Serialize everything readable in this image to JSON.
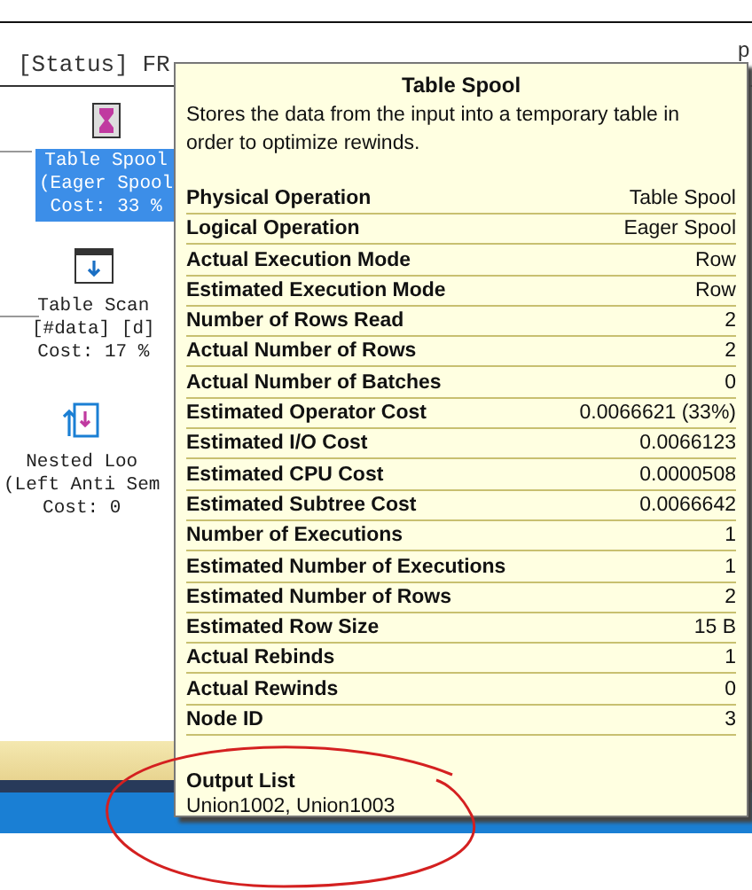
{
  "plan_header": {
    "text": "[Status] FR",
    "tail": "p"
  },
  "nodes": [
    {
      "kind": "spool",
      "selected": true,
      "lines": [
        "Table Spool",
        "(Eager Spool",
        "Cost: 33 %"
      ]
    },
    {
      "kind": "scan",
      "selected": false,
      "lines": [
        "Table Scan",
        "[#data] [d]",
        "Cost: 17 %"
      ]
    },
    {
      "kind": "loops",
      "selected": false,
      "lines": [
        "Nested Loo",
        "(Left Anti Sem",
        "Cost: 0"
      ]
    }
  ],
  "tooltip": {
    "title": "Table Spool",
    "description": "Stores the data from the input into a temporary table in order to optimize rewinds.",
    "properties": [
      {
        "name": "Physical Operation",
        "value": "Table Spool"
      },
      {
        "name": "Logical Operation",
        "value": "Eager Spool"
      },
      {
        "name": "Actual Execution Mode",
        "value": "Row"
      },
      {
        "name": "Estimated Execution Mode",
        "value": "Row"
      },
      {
        "name": "Number of Rows Read",
        "value": "2"
      },
      {
        "name": "Actual Number of Rows",
        "value": "2"
      },
      {
        "name": "Actual Number of Batches",
        "value": "0"
      },
      {
        "name": "Estimated Operator Cost",
        "value": "0.0066621 (33%)"
      },
      {
        "name": "Estimated I/O Cost",
        "value": "0.0066123"
      },
      {
        "name": "Estimated CPU Cost",
        "value": "0.0000508"
      },
      {
        "name": "Estimated Subtree Cost",
        "value": "0.0066642"
      },
      {
        "name": "Number of Executions",
        "value": "1"
      },
      {
        "name": "Estimated Number of Executions",
        "value": "1"
      },
      {
        "name": "Estimated Number of Rows",
        "value": "2"
      },
      {
        "name": "Estimated Row Size",
        "value": "15 B"
      },
      {
        "name": "Actual Rebinds",
        "value": "1"
      },
      {
        "name": "Actual Rewinds",
        "value": "0"
      },
      {
        "name": "Node ID",
        "value": "3"
      }
    ],
    "output_list": {
      "label": "Output List",
      "value": "Union1002, Union1003"
    }
  }
}
